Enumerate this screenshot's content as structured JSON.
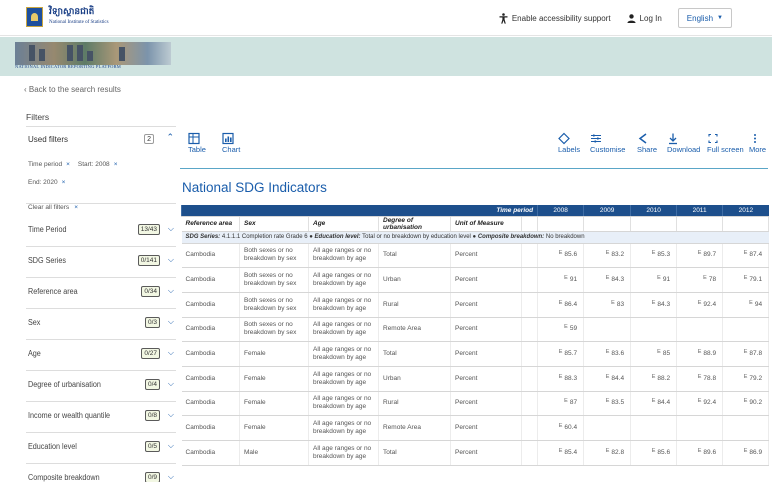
{
  "header": {
    "logo_native": "វិទ្យាស្ថានជាតិ",
    "logo_english": "National Institute of Statistics",
    "accessibility_label": "Enable accessibility support",
    "login_label": "Log In",
    "language_label": "English"
  },
  "banner": {
    "caption": "NATIONAL INDICATOR REPORTING PLATFORM"
  },
  "back_link": "‹ Back to the search results",
  "filters": {
    "title": "Filters",
    "used_title": "Used filters",
    "used_count": "2",
    "chips_row1": [
      {
        "label": "Time period"
      },
      {
        "label": "Start: 2008"
      }
    ],
    "chips_row2": [
      {
        "label": "End: 2020"
      }
    ],
    "clear_all": "Clear all filters",
    "facets": [
      {
        "name": "Time Period",
        "count": "13/43"
      },
      {
        "name": "SDG Series",
        "count": "0/141"
      },
      {
        "name": "Reference area",
        "count": "0/34"
      },
      {
        "name": "Sex",
        "count": "0/3"
      },
      {
        "name": "Age",
        "count": "0/27"
      },
      {
        "name": "Degree of urbanisation",
        "count": "0/4"
      },
      {
        "name": "Income or wealth quantile",
        "count": "0/8"
      },
      {
        "name": "Education level",
        "count": "0/5"
      },
      {
        "name": "Composite breakdown",
        "count": "0/9"
      }
    ]
  },
  "toolbar": {
    "table": "Table",
    "chart": "Chart",
    "labels": "Labels",
    "customise": "Customise",
    "share": "Share",
    "download": "Download",
    "fullscreen": "Full screen",
    "more": "More"
  },
  "page_title": "National SDG Indicators",
  "table": {
    "time_period_label": "Time period",
    "years": [
      "2008",
      "2009",
      "2010",
      "2011",
      "2012"
    ],
    "columns": [
      "Reference area",
      "Sex",
      "Age",
      "Degree of urbanisation",
      "Unit of Measure"
    ],
    "series_prefix": "SDG Series:",
    "series_value": "4.1.1.1 Completion rate Grade 6",
    "education_prefix": "Education level:",
    "education_value": "Total or no breakdown by education level",
    "composite_prefix": "Composite breakdown:",
    "composite_value": "No breakdown",
    "flag": "E",
    "rows": [
      {
        "area": "Cambodia",
        "sex": "Both sexes or no breakdown by sex",
        "age": "All age ranges or no breakdown by age",
        "urb": "Total",
        "unit": "Percent",
        "v": [
          "85.6",
          "83.2",
          "85.3",
          "89.7",
          "87.4"
        ]
      },
      {
        "area": "Cambodia",
        "sex": "Both sexes or no breakdown by sex",
        "age": "All age ranges or no breakdown by age",
        "urb": "Urban",
        "unit": "Percent",
        "v": [
          "91",
          "84.3",
          "91",
          "78",
          "79.1"
        ]
      },
      {
        "area": "Cambodia",
        "sex": "Both sexes or no breakdown by sex",
        "age": "All age ranges or no breakdown by age",
        "urb": "Rural",
        "unit": "Percent",
        "v": [
          "86.4",
          "83",
          "84.3",
          "92.4",
          "94"
        ]
      },
      {
        "area": "Cambodia",
        "sex": "Both sexes or no breakdown by sex",
        "age": "All age ranges or no breakdown by age",
        "urb": "Remote Area",
        "unit": "Percent",
        "v": [
          "59",
          "",
          "",
          "",
          ""
        ]
      },
      {
        "area": "Cambodia",
        "sex": "Female",
        "age": "All age ranges or no breakdown by age",
        "urb": "Total",
        "unit": "Percent",
        "v": [
          "85.7",
          "83.6",
          "85",
          "88.9",
          "87.8"
        ]
      },
      {
        "area": "Cambodia",
        "sex": "Female",
        "age": "All age ranges or no breakdown by age",
        "urb": "Urban",
        "unit": "Percent",
        "v": [
          "88.3",
          "84.4",
          "88.2",
          "78.8",
          "79.2"
        ]
      },
      {
        "area": "Cambodia",
        "sex": "Female",
        "age": "All age ranges or no breakdown by age",
        "urb": "Rural",
        "unit": "Percent",
        "v": [
          "87",
          "83.5",
          "84.4",
          "92.4",
          "90.2"
        ]
      },
      {
        "area": "Cambodia",
        "sex": "Female",
        "age": "All age ranges or no breakdown by age",
        "urb": "Remote Area",
        "unit": "Percent",
        "v": [
          "60.4",
          "",
          "",
          "",
          ""
        ]
      },
      {
        "area": "Cambodia",
        "sex": "Male",
        "age": "All age ranges or no breakdown by age",
        "urb": "Total",
        "unit": "Percent",
        "v": [
          "85.4",
          "82.8",
          "85.6",
          "89.6",
          "86.9"
        ]
      }
    ]
  }
}
